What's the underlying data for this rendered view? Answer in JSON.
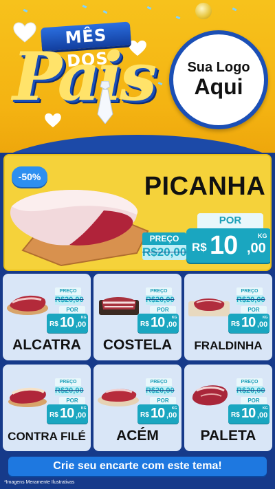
{
  "header": {
    "title_top": "MÊS DOS",
    "title_main": "Pais",
    "logo_line1": "Sua Logo",
    "logo_line2": "Aqui"
  },
  "featured": {
    "badge": "-50%",
    "name": "PICANHA",
    "preco_label": "PREÇO",
    "old_price": "R$20,00",
    "por_label": "POR",
    "currency": "R$",
    "price_int": "10",
    "price_cents": ",00",
    "unit": "KG"
  },
  "products": [
    {
      "name": "ALCATRA",
      "preco_label": "PREÇO",
      "old_price": "R$20,00",
      "por_label": "POR",
      "currency": "R$",
      "price_int": "10",
      "price_cents": ",00",
      "unit": "KG"
    },
    {
      "name": "COSTELA",
      "preco_label": "PREÇO",
      "old_price": "R$20,00",
      "por_label": "POR",
      "currency": "R$",
      "price_int": "10",
      "price_cents": ",00",
      "unit": "KG"
    },
    {
      "name": "FRALDINHA",
      "preco_label": "PREÇO",
      "old_price": "R$20,00",
      "por_label": "POR",
      "currency": "R$",
      "price_int": "10",
      "price_cents": ",00",
      "unit": "KG"
    },
    {
      "name": "CONTRA FILÉ",
      "preco_label": "PREÇO",
      "old_price": "R$20,00",
      "por_label": "POR",
      "currency": "R$",
      "price_int": "10",
      "price_cents": ",00",
      "unit": "KG"
    },
    {
      "name": "ACÉM",
      "preco_label": "PREÇO",
      "old_price": "R$20,00",
      "por_label": "POR",
      "currency": "R$",
      "price_int": "10",
      "price_cents": ",00",
      "unit": "KG"
    },
    {
      "name": "PALETA",
      "preco_label": "PREÇO",
      "old_price": "R$20,00",
      "por_label": "POR",
      "currency": "R$",
      "price_int": "10",
      "price_cents": ",00",
      "unit": "KG"
    }
  ],
  "cta": {
    "label": "Crie seu encarte com este tema!"
  },
  "footnote": "*Imagens Meramente Ilustrativas",
  "colors": {
    "yellow": "#f5c21c",
    "blue": "#163a8a",
    "teal": "#1aa6c0",
    "cta_blue": "#1e78e0"
  },
  "icons": [
    "heart-icon",
    "tie-icon",
    "coin-icon",
    "meat-icon"
  ]
}
